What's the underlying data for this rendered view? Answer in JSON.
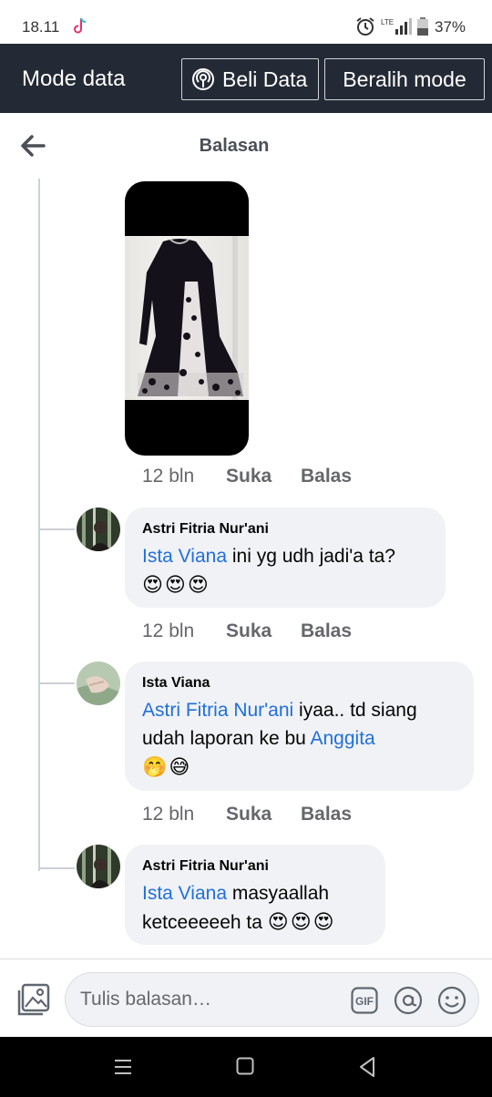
{
  "status_bar": {
    "time": "18.11",
    "battery": "37%",
    "network": "LTE"
  },
  "data_banner": {
    "title": "Mode data",
    "buy_label": "Beli Data",
    "switch_label": "Beralih mode"
  },
  "header": {
    "title": "Balasan"
  },
  "image_post": {
    "time": "12 bln",
    "like": "Suka",
    "reply": "Balas"
  },
  "comments": [
    {
      "author": "Astri Fitria Nur'ani",
      "mention": "Ista Viana",
      "text": " ini yg udh jadi'a ta?",
      "emojis": "😍😍😍",
      "time": "12 bln",
      "like": "Suka",
      "reply": "Balas"
    },
    {
      "author": "Ista Viana",
      "mention": "Astri Fitria Nur'ani",
      "text": " iyaa.. td siang",
      "text2": "udah laporan ke bu ",
      "mention2": "Anggita",
      "emojis": "🤭😅",
      "time": "12 bln",
      "like": "Suka",
      "reply": "Balas"
    },
    {
      "author": "Astri Fitria Nur'ani",
      "mention": "Ista Viana",
      "text": " masyaallah",
      "text2": "ketceeeeeh ta ",
      "emojis": "😍😍😍"
    }
  ],
  "composer": {
    "placeholder": "Tulis balasan…",
    "gif_label": "GIF"
  },
  "colors": {
    "banner_bg": "#242a35",
    "mention": "#216fdb",
    "bubble_bg": "#f0f2f5"
  }
}
